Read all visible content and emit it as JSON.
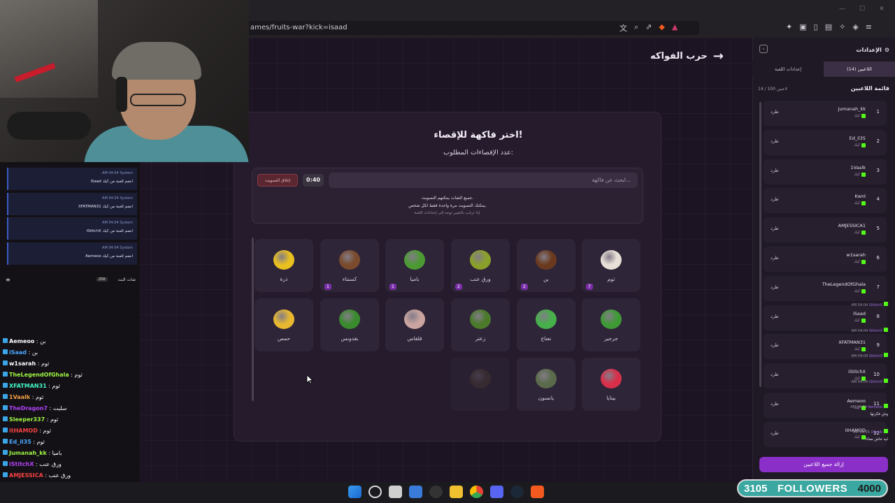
{
  "browser": {
    "url": "ames/fruits-war?kick=isaad"
  },
  "page": {
    "header_title": "حرب الفواكه",
    "card_title": "اختر فاكهة للإقصاء!",
    "card_subtitle": "عدد الإقصاءات المطلوب:",
    "search_placeholder": "ابحث عن فاكهة...",
    "timer": "0:40",
    "close_vote_label": "إغلاق التصويت",
    "vote_line1": "جميع الشات يمكنهم التصويت.",
    "vote_line2": "يمكنك التصويت مرة واحدة فقط لكل شخص.",
    "vote_line3": "إذا ترغب بالتغيير توجه إلى إعدادات اللعبة.",
    "fruits_row1": [
      {
        "label": "ثوم",
        "votes": "7",
        "color": "#e8e0d8"
      },
      {
        "label": "بن",
        "votes": "2",
        "color": "#6b3a1e"
      },
      {
        "label": "ورق عنب",
        "votes": "2",
        "color": "#8aa02a"
      },
      {
        "label": "باميا",
        "votes": "1",
        "color": "#4c9a34"
      },
      {
        "label": "كستناء",
        "votes": "1",
        "color": "#7a4a2c"
      },
      {
        "label": "ذرة",
        "votes": "",
        "color": "#e8c020"
      }
    ],
    "fruits_row2": [
      {
        "label": "جرجير",
        "votes": "",
        "color": "#3f9a36"
      },
      {
        "label": "نعناع",
        "votes": "",
        "color": "#46b04a"
      },
      {
        "label": "زعتر",
        "votes": "",
        "color": "#4a7a2a"
      },
      {
        "label": "قلقاس",
        "votes": "",
        "color": "#c9a4a0"
      },
      {
        "label": "بقدونس",
        "votes": "",
        "color": "#3a8a2e"
      },
      {
        "label": "حمص",
        "votes": "",
        "color": "#e8b830"
      }
    ],
    "fruits_row3": [
      {
        "label": "بيتايا",
        "votes": "",
        "color": "#d8304a"
      },
      {
        "label": "يانسون",
        "votes": "",
        "color": "#5a6a4a"
      },
      {
        "label": "",
        "votes": "",
        "color": "#5a4a3a"
      }
    ]
  },
  "panel": {
    "title": "الإعدادات",
    "tab_players": "اللاعبين (14)",
    "tab_settings": "إعدادات اللعبة",
    "list_title": "قائمة اللاعبين",
    "list_count": "14 / 100 لاعبين",
    "kick_label": "طرد",
    "kick_tag": "كيك",
    "players": [
      {
        "num": "1",
        "name": "Jumanah_kk"
      },
      {
        "num": "2",
        "name": "Ed_il35"
      },
      {
        "num": "3",
        "name": "1Vaalk"
      },
      {
        "num": "4",
        "name": "Kwnl"
      },
      {
        "num": "5",
        "name": "AMJESSICA1"
      },
      {
        "num": "6",
        "name": "w1sarah"
      },
      {
        "num": "7",
        "name": "TheLegendOfGhala"
      },
      {
        "num": "8",
        "name": "iSaad"
      },
      {
        "num": "9",
        "name": "XFATMAN31"
      },
      {
        "num": "10",
        "name": "iStitchX"
      },
      {
        "num": "11",
        "name": "Aemeoo"
      },
      {
        "num": "12",
        "name": "itHAMOD"
      }
    ],
    "remove_all": "إزالة جميع اللاعبين"
  },
  "chat": {
    "header_title": "شات البث",
    "header_count": "256",
    "system_msgs": [
      {
        "meta": "AM 04:04 System",
        "text": "iSaad انضم للعبة من كيك"
      },
      {
        "meta": "AM 04:04 System",
        "text": "XFATMAN31 انضم للعبة من كيك"
      },
      {
        "meta": "AM 04:04 System",
        "text": "iStitchX انضم للعبة من كيك"
      },
      {
        "meta": "AM 04:04 System",
        "text": "Aemeoo انضم للعبة من كيك"
      }
    ],
    "right_msgs": [
      {
        "meta": "AM 04:04",
        "user": "iStitchX",
        "body": ""
      },
      {
        "meta": "AM 04:04",
        "user": "iStitchX",
        "body": ""
      },
      {
        "meta": "AM 04:04",
        "user": "iStitchX",
        "body": ""
      },
      {
        "meta": "AM 04:04",
        "user": "iStitchX",
        "body": ""
      },
      {
        "meta": "AM 04:04",
        "user": "Aemeoo",
        "body": "وش فكرتها"
      },
      {
        "meta": "AM 04:05",
        "user": "1Vaalk",
        "body": "ليه خاش معانا"
      }
    ],
    "left_msgs": [
      {
        "user": "Aemeoo",
        "text": " : بن",
        "color": "#ffffff"
      },
      {
        "user": "iSaad",
        "text": " : بن",
        "color": "#4aa8ff"
      },
      {
        "user": "w1sarah",
        "text": " : ثوم",
        "color": "#ffffff"
      },
      {
        "user": "TheLegendOfGhala",
        "text": " : ثوم",
        "color": "#9ef542"
      },
      {
        "user": "XFATMAN31",
        "text": " : ثوم",
        "color": "#42f5c5"
      },
      {
        "user": "1Vaalk",
        "text": " : ثوم",
        "color": "#f5a142"
      },
      {
        "user": "TheDragon7",
        "text": " : سلبت",
        "color": "#b042f5"
      },
      {
        "user": "Sleeper337",
        "text": " : ثوم",
        "color": "#9ef542"
      },
      {
        "user": "itHAMOD",
        "text": " : ثوم",
        "color": "#f54242"
      },
      {
        "user": "Ed_il35",
        "text": " : ثوم",
        "color": "#4aa8ff"
      },
      {
        "user": "Jumanah_kk",
        "text": " : باميا",
        "color": "#9ef542"
      },
      {
        "user": "iStitchX",
        "text": " : ورق عنب",
        "color": "#b042f5"
      },
      {
        "user": "AMJESSICA",
        "text": " : ورق عنب",
        "color": "#f54242"
      },
      {
        "user": "itHAMOD",
        "text": "",
        "color": "#ffffff"
      }
    ]
  },
  "overlay": {
    "followers_count": "3105",
    "followers_label": "FOLLOWERS",
    "followers_goal": "4000"
  }
}
